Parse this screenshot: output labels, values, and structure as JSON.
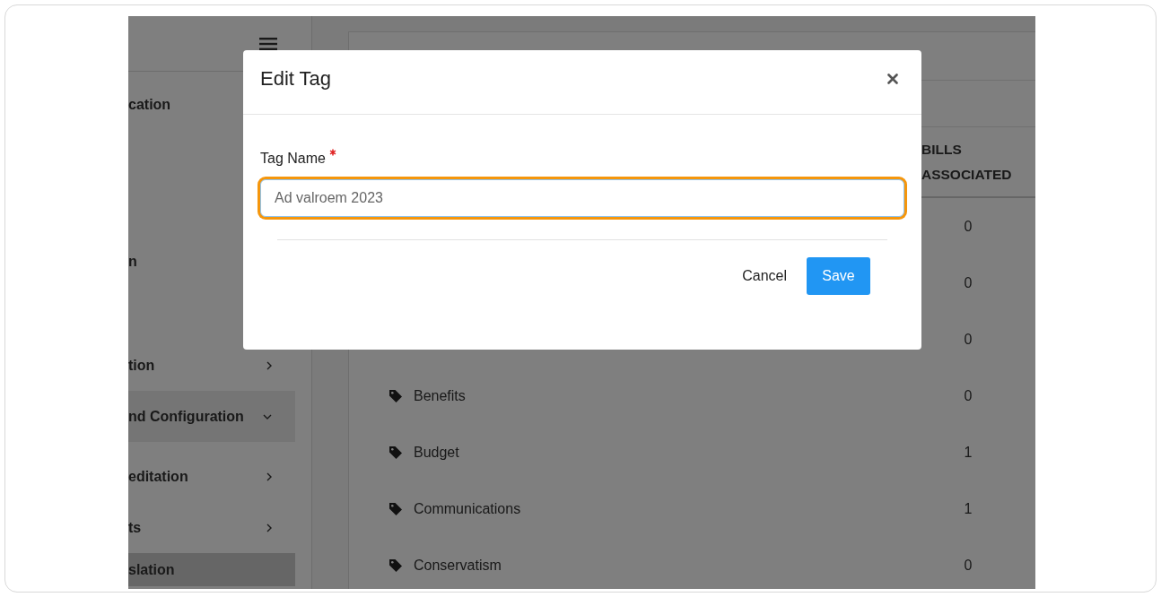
{
  "sidebar": {
    "items": [
      {
        "label": "cation",
        "kind": "link",
        "selected": false
      },
      {
        "label": "n",
        "kind": "link",
        "selected": false
      },
      {
        "label": "tion",
        "kind": "group",
        "expanded": false,
        "selected": false
      },
      {
        "label": "nd Configuration",
        "kind": "group",
        "expanded": true,
        "selected": false
      },
      {
        "label": "editation",
        "kind": "group",
        "expanded": false,
        "selected": false
      },
      {
        "label": "ts",
        "kind": "group",
        "expanded": false,
        "selected": false
      },
      {
        "label": "slation",
        "kind": "link",
        "selected": true
      }
    ]
  },
  "table": {
    "columns": [
      "BILLS ASSOCIATED"
    ],
    "rows": [
      {
        "bills_associated": "0"
      },
      {
        "bills_associated": "0"
      },
      {
        "bills_associated": "0"
      },
      {
        "name": "Benefits",
        "bills_associated": "0"
      },
      {
        "name": "Budget",
        "bills_associated": "1"
      },
      {
        "name": "Communications",
        "bills_associated": "1"
      },
      {
        "name": "Conservatism",
        "bills_associated": "0"
      }
    ]
  },
  "dialog": {
    "title": "Edit Tag",
    "field": {
      "label": "Tag Name",
      "required": true,
      "value": "Ad valroem 2023",
      "focused": true
    },
    "buttons": [
      {
        "label": "Cancel",
        "kind": "text"
      },
      {
        "label": "Save",
        "kind": "primary"
      }
    ]
  }
}
